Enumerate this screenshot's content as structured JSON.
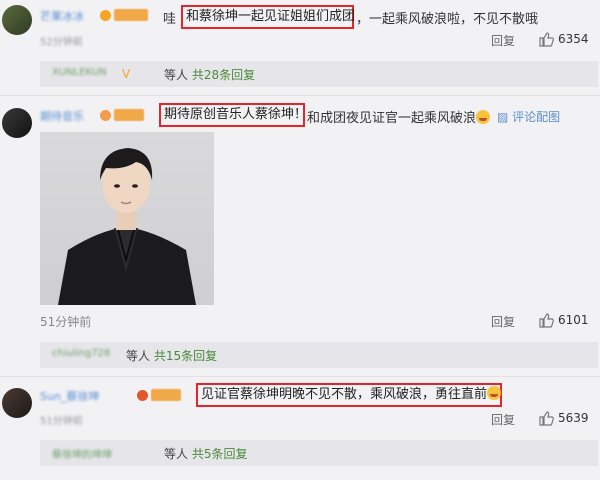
{
  "comments": [
    {
      "prefix": "哇",
      "highlight": "和蔡徐坤一起见证姐姐们成团",
      "suffix": "，一起乘风破浪啦，不见不散哦",
      "username": "芒果冰冰",
      "time_blurred": "52分钟前",
      "reply": "回复",
      "likes": "6354",
      "thread": {
        "names": "XUNLEKUN",
        "suffix": "等人",
        "link": "共28条回复"
      }
    },
    {
      "highlight": "期待原创音乐人蔡徐坤！",
      "suffix": "和成团夜见证官一起乘风破浪",
      "image_link": "评论配图",
      "username": "期待音乐",
      "time": "51分钟前",
      "reply": "回复",
      "likes": "6101",
      "thread": {
        "names": "chiuling728",
        "suffix": "等人",
        "link": "共15条回复"
      }
    },
    {
      "highlight": "见证官蔡徐坤明晚不见不散，乘风破浪，勇往直前",
      "username": "Sun_蔡徐坤",
      "time_blurred": "51分钟前",
      "reply": "回复",
      "likes": "5639",
      "thread": {
        "names": "蔡徐坤的坤坤",
        "suffix": "等人",
        "link": "共5条回复"
      }
    }
  ]
}
